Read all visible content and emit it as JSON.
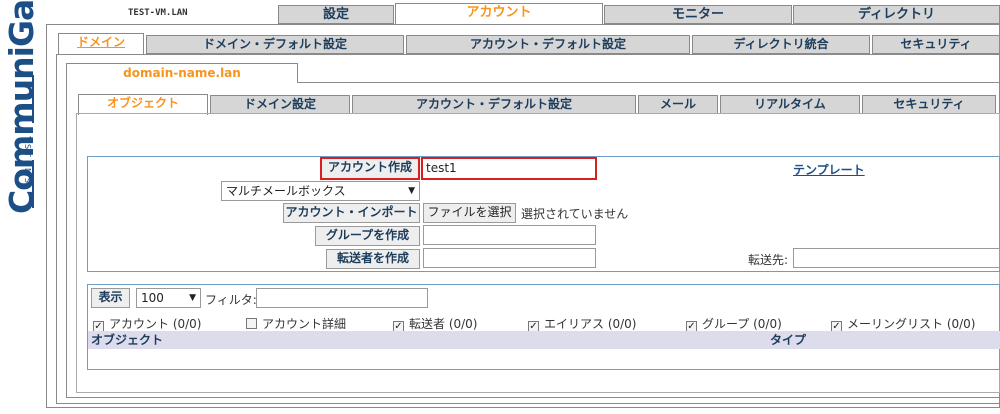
{
  "logo": {
    "brand": "CommuniGate",
    "sub": "SYSTEMS"
  },
  "hostname": "TEST-VM.LAN",
  "top_tabs": [
    {
      "label": "設定",
      "active": false
    },
    {
      "label": "アカウント",
      "active": true
    },
    {
      "label": "モニター",
      "active": false
    },
    {
      "label": "ディレクトリ",
      "active": false
    }
  ],
  "second_tabs": [
    {
      "label": "ドメイン",
      "active": true
    },
    {
      "label": "ドメイン・デフォルト設定",
      "active": false
    },
    {
      "label": "アカウント・デフォルト設定",
      "active": false
    },
    {
      "label": "ディレクトリ統合",
      "active": false
    },
    {
      "label": "セキュリティ",
      "active": false
    }
  ],
  "domain_tab": "domain-name.lan",
  "object_tabs": [
    {
      "label": "オブジェクト",
      "active": true
    },
    {
      "label": "ドメイン設定",
      "active": false
    },
    {
      "label": "アカウント・デフォルト設定",
      "active": false
    },
    {
      "label": "メール",
      "active": false
    },
    {
      "label": "リアルタイム",
      "active": false
    },
    {
      "label": "セキュリティ",
      "active": false
    }
  ],
  "create_form": {
    "create_account_btn": "アカウント作成",
    "account_name_value": "test1",
    "template_link": "テンプレート",
    "mailbox_type": "マルチメールボックス",
    "import_btn": "アカウント・インポート",
    "file_btn": "ファイルを選択",
    "no_file_text": "選択されていません",
    "create_group_btn": "グループを作成",
    "create_forwarder_btn": "転送者を作成",
    "forward_to_label": "転送先:"
  },
  "list": {
    "show_btn": "表示",
    "count": "100",
    "filter_label": "フィルタ:",
    "filter_value": "",
    "checkboxes": [
      {
        "label": "アカウント (0/0)",
        "checked": true
      },
      {
        "label": "アカウント詳細",
        "checked": false
      },
      {
        "label": "転送者 (0/0)",
        "checked": true
      },
      {
        "label": "エイリアス (0/0)",
        "checked": true
      },
      {
        "label": "グループ (0/0)",
        "checked": true
      },
      {
        "label": "メーリングリスト (0/0)",
        "checked": true
      }
    ],
    "col_object": "オブジェクト",
    "col_type": "タイプ"
  }
}
